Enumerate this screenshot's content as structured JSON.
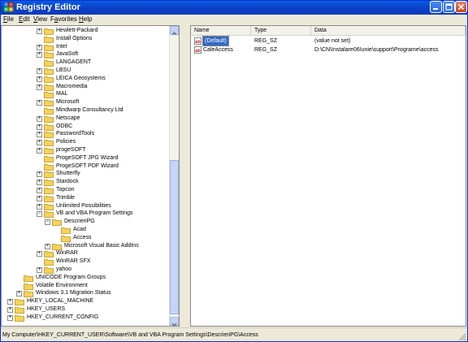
{
  "window": {
    "title": "Registry Editor"
  },
  "menu": [
    {
      "label": "File",
      "u": "F",
      "rest": "ile"
    },
    {
      "label": "Edit",
      "u": "E",
      "rest": "dit"
    },
    {
      "label": "View",
      "u": "V",
      "rest": "iew"
    },
    {
      "label": "Favorites",
      "u": "",
      "pre": "F",
      "uc": "a",
      "rest": "vorites"
    },
    {
      "label": "Help",
      "u": "H",
      "rest": "elp"
    }
  ],
  "tree": [
    {
      "label": "Hewlett-Packard",
      "level": 1,
      "exp": "+"
    },
    {
      "label": "Install Options",
      "level": 1,
      "exp": ""
    },
    {
      "label": "Intel",
      "level": 1,
      "exp": "+"
    },
    {
      "label": "JavaSoft",
      "level": 1,
      "exp": "+"
    },
    {
      "label": "LANGAGENT",
      "level": 1,
      "exp": ""
    },
    {
      "label": "LBSU",
      "level": 1,
      "exp": "+"
    },
    {
      "label": "LEICA Geosystems",
      "level": 1,
      "exp": "+"
    },
    {
      "label": "Macromedia",
      "level": 1,
      "exp": "+"
    },
    {
      "label": "MAL",
      "level": 1,
      "exp": ""
    },
    {
      "label": "Microsoft",
      "level": 1,
      "exp": "+"
    },
    {
      "label": "Mindwarp Consultancy Ltd",
      "level": 1,
      "exp": ""
    },
    {
      "label": "Netscape",
      "level": 1,
      "exp": "+"
    },
    {
      "label": "ODBC",
      "level": 1,
      "exp": "+"
    },
    {
      "label": "PasswordTools",
      "level": 1,
      "exp": "+"
    },
    {
      "label": "Policies",
      "level": 1,
      "exp": "+"
    },
    {
      "label": "progeSOFT",
      "level": 1,
      "exp": "+"
    },
    {
      "label": "ProgeSOFT JPG Wizard",
      "level": 1,
      "exp": ""
    },
    {
      "label": "ProgeSOFT PDF Wizard",
      "level": 1,
      "exp": ""
    },
    {
      "label": "Shutterfly",
      "level": 1,
      "exp": "+"
    },
    {
      "label": "Stardock",
      "level": 1,
      "exp": "+"
    },
    {
      "label": "Topcon",
      "level": 1,
      "exp": "+"
    },
    {
      "label": "Trimble",
      "level": 1,
      "exp": "+"
    },
    {
      "label": "Unlimited Possibilities",
      "level": 1,
      "exp": "+"
    },
    {
      "label": "VB and VBA Program Settings",
      "level": 1,
      "exp": "-"
    },
    {
      "label": "DescrieriPG",
      "level": 2,
      "exp": "-"
    },
    {
      "label": "Acad",
      "level": 3,
      "exp": ""
    },
    {
      "label": "Access",
      "level": 3,
      "exp": ""
    },
    {
      "label": "Microsoft Visual Basic AddIns",
      "level": 2,
      "exp": "+"
    },
    {
      "label": "WinRAR",
      "level": 1,
      "exp": "+"
    },
    {
      "label": "WinRAR SFX",
      "level": 1,
      "exp": ""
    },
    {
      "label": "yahoo",
      "level": 1,
      "exp": "+"
    },
    {
      "label": "UNICODE Program Groups",
      "level": 0,
      "exp": ""
    },
    {
      "label": "Volatile Environment",
      "level": 0,
      "exp": ""
    },
    {
      "label": "Windows 3.1 Migration Status",
      "level": 0,
      "exp": "+"
    },
    {
      "label": "HKEY_LOCAL_MACHINE",
      "level": -1,
      "exp": "+"
    },
    {
      "label": "HKEY_USERS",
      "level": -1,
      "exp": "+"
    },
    {
      "label": "HKEY_CURRENT_CONFIG",
      "level": -1,
      "exp": "+"
    }
  ],
  "list": {
    "headers": [
      "Name",
      "Type",
      "Data"
    ],
    "rows": [
      {
        "name": "(Default)",
        "type": "REG_SZ",
        "data": "(value not set)",
        "selected": true
      },
      {
        "name": "CaleAccess",
        "type": "REG_SZ",
        "data": "D:\\CN\\Instalare06Iunie\\support\\Programe\\access",
        "selected": false
      }
    ]
  },
  "status": {
    "path": "My Computer\\HKEY_CURRENT_USER\\Software\\VB and VBA Program Settings\\DescrieriPG\\Access"
  },
  "colors": {
    "selection": "#316ac5",
    "title": "#0a3fc7",
    "folder": "#f5d35a"
  }
}
